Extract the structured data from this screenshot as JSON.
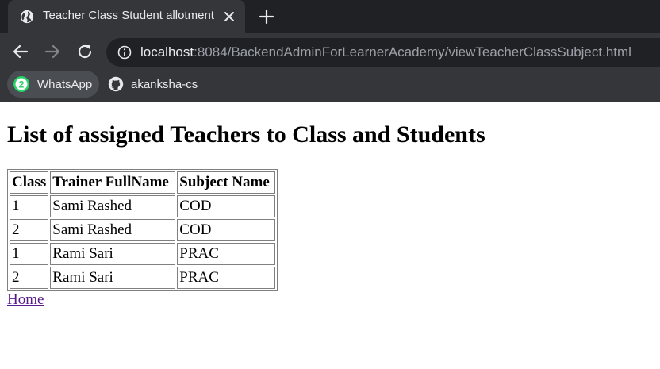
{
  "browser": {
    "tab": {
      "title": "Teacher Class Student allotment",
      "icon": "globe-icon"
    },
    "address": {
      "host": "localhost",
      "rest": ":8084/BackendAdminForLearnerAcademy/viewTeacherClassSubject.html"
    },
    "bookmarks": [
      {
        "label": "WhatsApp",
        "icon": "whatsapp-icon",
        "badge": "2"
      },
      {
        "label": "akanksha-cs",
        "icon": "github-icon"
      }
    ]
  },
  "page": {
    "heading": "List of assigned Teachers to Class and Students",
    "table": {
      "headers": [
        "Class",
        "Trainer FullName",
        "Subject Name"
      ],
      "rows": [
        [
          "1",
          "Sami Rashed",
          "COD"
        ],
        [
          "2",
          "Sami Rashed",
          "COD"
        ],
        [
          "1",
          "Rami Sari",
          "PRAC"
        ],
        [
          "2",
          "Rami Sari",
          "PRAC"
        ]
      ]
    },
    "home_link": "Home"
  },
  "colors": {
    "chrome_dark": "#202124",
    "chrome": "#35363a",
    "link_visited": "#551a8b",
    "whatsapp": "#25d366"
  }
}
